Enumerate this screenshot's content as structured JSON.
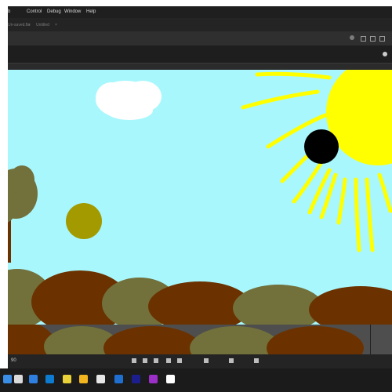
{
  "menu": {
    "items": [
      "b",
      "Control",
      "Debug",
      "Window",
      "Help"
    ]
  },
  "tabs": [
    {
      "label": "Un-saved.fla",
      "close": "×"
    },
    {
      "label": "Untitled",
      "close": "×"
    }
  ],
  "status": {
    "zoom": "90"
  },
  "colors": {
    "sky": "#a8f7fd",
    "sun": "#ffff00",
    "black_circle": "#000000",
    "gold_circle": "#a39a00",
    "brown_hill": "#6b3200",
    "olive_hill": "#72703b",
    "cloud": "#ffffff"
  },
  "icons": {
    "toolbar": [
      "play-icon",
      "grid-icon",
      "settings-icon",
      "window-icon"
    ],
    "status_buttons": [
      "rewind-icon",
      "step-back-icon",
      "play-icon",
      "step-forward-icon",
      "loop-icon",
      "onion-skin-icon",
      "edit-icon",
      "play-icon"
    ],
    "taskbar": [
      "windows-start-icon",
      "search-icon",
      "taskview-icon",
      "edge-icon",
      "chrome-icon",
      "explorer-icon",
      "store-icon",
      "mail-icon",
      "photoshop-icon",
      "animate-icon",
      "word-icon"
    ]
  }
}
